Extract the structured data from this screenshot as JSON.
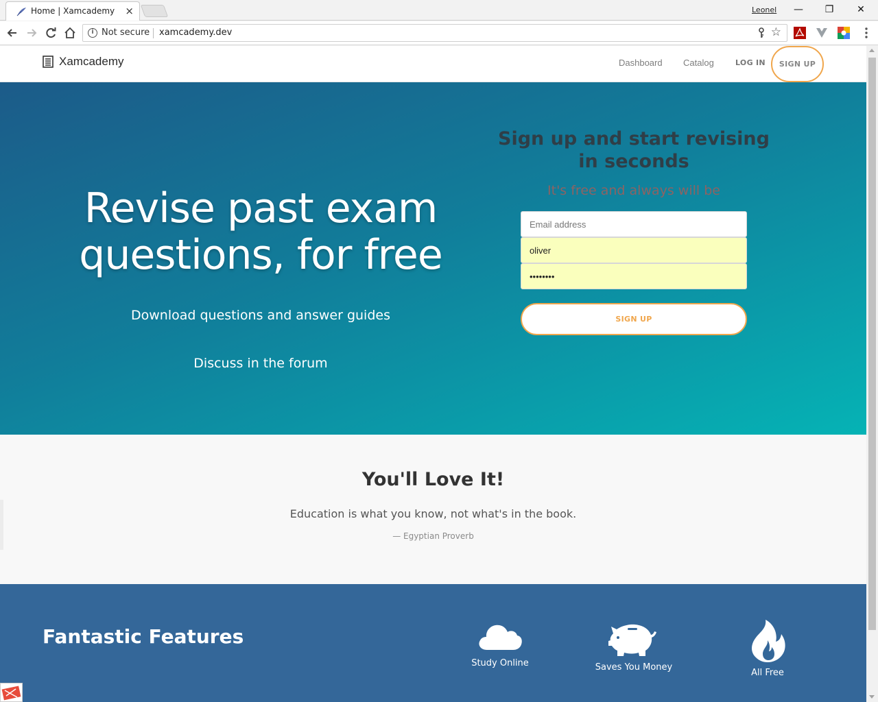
{
  "browser": {
    "tab_title": "Home | Xamcademy",
    "tab_close": "×",
    "profile_name": "Leonel",
    "window_controls": {
      "minimize": "—",
      "restore": "❐",
      "close": "✕"
    },
    "security_label": "Not secure",
    "url": "xamcademy.dev"
  },
  "nav": {
    "brand": "Xamcademy",
    "links": [
      "Dashboard",
      "Catalog"
    ],
    "login": "LOG IN",
    "signup": "SIGN UP"
  },
  "hero": {
    "title": "Revise past exam questions, for free",
    "lines": [
      "Download questions and answer guides",
      "Discuss in the forum"
    ],
    "signup_title": "Sign up and start revising in seconds",
    "signup_sub": "It's free and always will be",
    "form": {
      "email_placeholder": "Email address",
      "email_value": "",
      "username_value": "oliver",
      "password_value": "••••••••",
      "submit": "SIGN UP"
    }
  },
  "quote": {
    "title": "You'll Love It!",
    "text": "Education is what you know, not what's in the book.",
    "source": "— Egyptian Proverb"
  },
  "features": {
    "title": "Fantastic Features",
    "items": [
      {
        "label": "Study Online",
        "icon": "cloud-icon"
      },
      {
        "label": "Saves You Money",
        "icon": "piggy-bank-icon"
      },
      {
        "label": "All Free",
        "icon": "fire-icon"
      }
    ]
  },
  "colors": {
    "accent_orange": "#f0a64c",
    "hero_start": "#1c5b89",
    "hero_end": "#05b3b5",
    "features_bg": "#346799",
    "autofill": "#faffbd"
  }
}
